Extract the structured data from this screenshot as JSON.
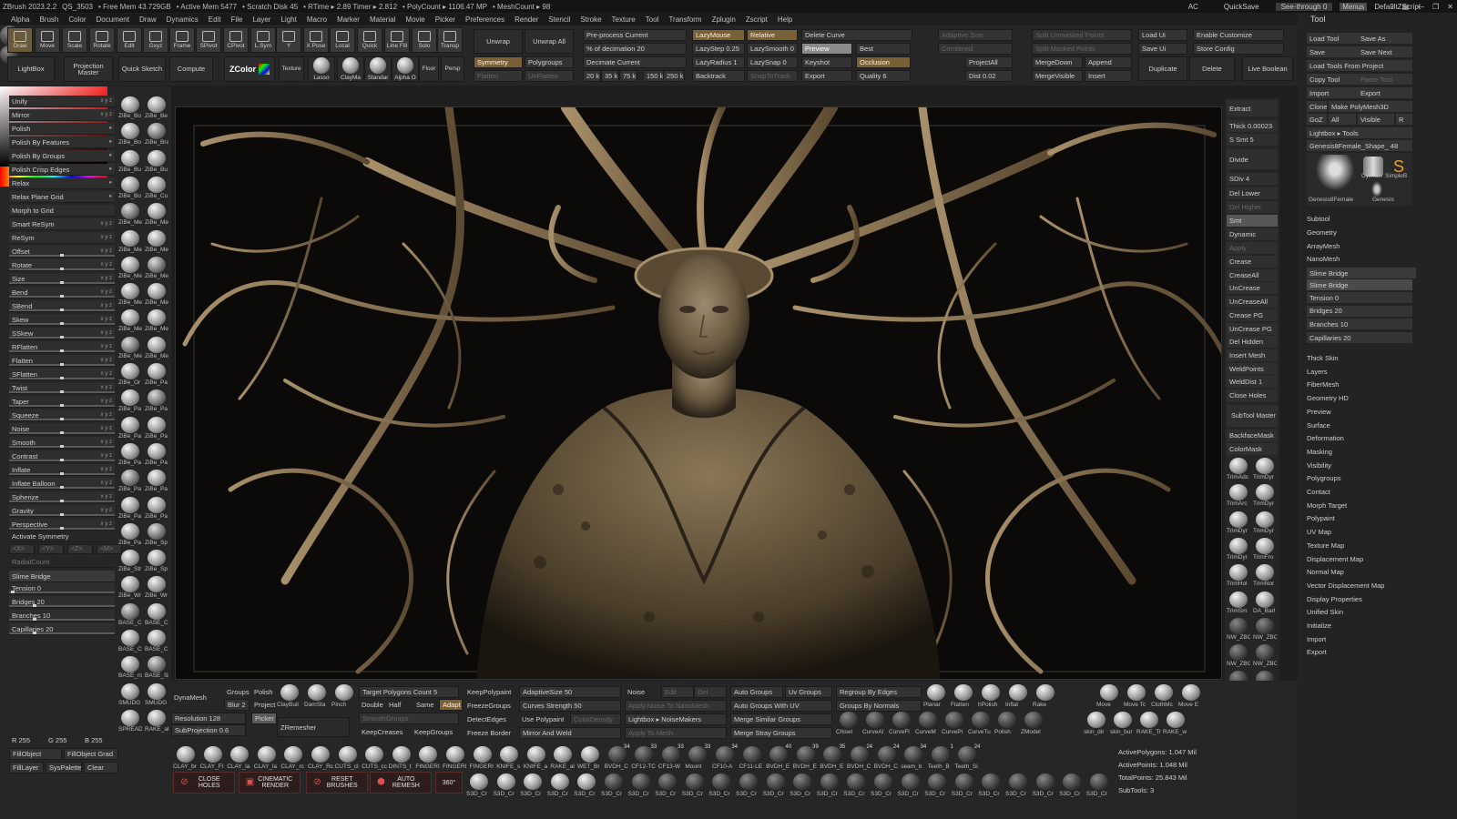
{
  "titlebar": {
    "items": [
      "ZBrush 2023.2.2",
      "QS_3503",
      "• Free Mem 43.729GB",
      "• Active Mem 5477",
      "• Scratch Disk 45",
      "• RTime ▸ 2.89 Timer ▸ 2.812",
      "• PolyCount ▸ 1106.47 MP",
      "• MeshCount ▸ 98"
    ],
    "right": {
      "ac": "AC",
      "quicksave": "QuickSave",
      "seethrough": "See-through  0",
      "menus": "Menus",
      "script": "DefaultZScript"
    }
  },
  "menubar": [
    "Alpha",
    "Brush",
    "Color",
    "Document",
    "Draw",
    "Dynamics",
    "Edit",
    "File",
    "Layer",
    "Light",
    "Macro",
    "Marker",
    "Material",
    "Movie",
    "Picker",
    "Preferences",
    "Render",
    "Stencil",
    "Stroke",
    "Texture",
    "Tool",
    "Transform",
    "Zplugin",
    "Zscript",
    "Help"
  ],
  "shelf": {
    "tools": [
      "Draw",
      "Move",
      "Scale",
      "Rotate",
      "Edit",
      "Gxyz",
      "Frame",
      "SPivot",
      "CPivot",
      "L.Sym",
      "Y",
      "X Pose",
      "Local",
      "Quick",
      "Line Fill",
      "Solo",
      "Transp"
    ],
    "row2": [
      "LightBox",
      "Projection Master",
      "Quick Sketch",
      "Compute",
      "ZColor",
      "Texture",
      "Lasso",
      "ClayMa",
      "Standar",
      "Alpha O",
      "Floor",
      "Persp"
    ],
    "unwrap": "Unwrap",
    "unwrap_all": "Unwrap All",
    "symmetry": "Symmetry",
    "flatten": "Flatten",
    "polygroups": "Polygroups",
    "unflatten": "UnFlatten",
    "preprocess": "Pre-process Current",
    "decimation": "% of decimation 20",
    "decimate": "Decimate Current",
    "dec_sizes": [
      "20 k",
      "35 k",
      "75 k",
      "150 k",
      "250 k"
    ],
    "lazymouse": "LazyMouse",
    "lazystep": "LazyStep 0.25",
    "lazyradius": "LazyRadius 1",
    "backtrack": "Backtrack",
    "relative": "Relative",
    "lazysmooth": "LazySmooth 0",
    "lazysnap": "LazySnap 0",
    "snaptotrack": "SnapToTrack",
    "deletecurve": "Delete Curve",
    "preview": "Preview",
    "best": "Best",
    "keyshot": "Keyshot",
    "occlusion": "Occlusion",
    "export": "Export",
    "quality": "Quality 6",
    "bpr": "BPR",
    "adaptive": "Adaptive Size",
    "combined": "Combined",
    "projectall": "ProjectAll",
    "dist": "Dist 0.02",
    "split_unmasked": "Split Unmasked Points",
    "split_masked": "Split Masked Points",
    "mergedown": "MergeDown",
    "mergevisible": "MergeVisible",
    "append": "Append",
    "insert": "Insert",
    "loadui": "Load Ui",
    "saveui": "Save Ui",
    "duplicate": "Duplicate",
    "delete": "Delete",
    "enable_customize": "Enable Customize",
    "store_config": "Store Config",
    "live_boolean": "Live Boolean"
  },
  "left": {
    "deformations": [
      {
        "label": "Unify",
        "k": "x y z"
      },
      {
        "label": "Mirror",
        "k": "x y z"
      },
      {
        "label": "Polish",
        "k": "●"
      },
      {
        "label": "Polish By Features",
        "k": "●"
      },
      {
        "label": "Polish By Groups",
        "k": "●"
      },
      {
        "label": "Polish Crisp Edges",
        "k": "●"
      },
      {
        "label": "Relax",
        "k": "●"
      },
      {
        "label": "Relax Plane Grid",
        "k": "●"
      },
      {
        "label": "Morph to Grid",
        "k": ""
      },
      {
        "label": "Smart ReSym",
        "k": "x y z"
      },
      {
        "label": "ReSym",
        "k": "x y z"
      },
      {
        "label": "Offset",
        "k": "x y z"
      },
      {
        "label": "Rotate",
        "k": "x y z"
      },
      {
        "label": "Size",
        "k": "x y z"
      },
      {
        "label": "Bend",
        "k": "x y z"
      },
      {
        "label": "SBend",
        "k": "x y z"
      },
      {
        "label": "Skew",
        "k": "x y z"
      },
      {
        "label": "SSkew",
        "k": "x y z"
      },
      {
        "label": "RFlatten",
        "k": "x y z"
      },
      {
        "label": "Flatten",
        "k": "x y z"
      },
      {
        "label": "SFlatten",
        "k": "x y z"
      },
      {
        "label": "Twist",
        "k": "x y z"
      },
      {
        "label": "Taper",
        "k": "x y z"
      },
      {
        "label": "Squeeze",
        "k": "x y z"
      },
      {
        "label": "Noise",
        "k": "x y z"
      },
      {
        "label": "Smooth",
        "k": "x y z"
      },
      {
        "label": "Contrast",
        "k": "x y z"
      },
      {
        "label": "Inflate",
        "k": "x y z"
      },
      {
        "label": "Inflate Balloon",
        "k": "x y z"
      },
      {
        "label": "Spherize",
        "k": "x y z"
      },
      {
        "label": "Gravity",
        "k": "x y z"
      },
      {
        "label": "Perspective",
        "k": "x y z"
      }
    ],
    "activate_symmetry": "Activate Symmetry",
    "axes": [
      "<X>",
      "<Y>",
      "<Z>",
      "<M>"
    ],
    "radial": "(R)",
    "radialcount": "RadialCount",
    "slime": {
      "title": "Slime Bridge",
      "tension": "Tension 0",
      "bridges": "Bridges 20",
      "branches": "Branches 10",
      "capillaries": "Capillaries 20"
    },
    "thumbs": [
      "ZiBe_Bo",
      "ZiBe_Be",
      "ZiBe_Bo",
      "ZiBe_Bra",
      "ZiBe_Bu",
      "ZiBe_Bu",
      "ZiBe_Bo",
      "ZiBe_Cu",
      "ZiBe_Me",
      "ZiBe_Me",
      "ZiBe_Me",
      "ZiBe_Me",
      "ZiBe_Me",
      "ZiBe_Me",
      "ZiBe_Me",
      "ZiBe_Me",
      "ZiBe_Me",
      "ZiBe_Me",
      "ZiBe_Me",
      "ZiBe_Me",
      "ZiBe_Or",
      "ZiBe_Pa",
      "ZiBe_Pa",
      "ZiBe_Pa",
      "ZiBe_Pa",
      "ZiBe_Pa",
      "ZiBe_Pa",
      "ZiBe_Pa",
      "ZiBe_Pa",
      "ZiBe_Pa",
      "ZiBe_Pa",
      "ZiBe_Pa",
      "ZiBe_Pa",
      "ZiBe_Sp",
      "ZiBe_Str",
      "ZiBe_Sp",
      "ZiBe_Wr",
      "ZiBe_Wr",
      "BASE_C",
      "BASE_Cl",
      "BASE_Cl",
      "BASE_Cl",
      "BASE_rc",
      "BASE_Sr",
      "SMUDG",
      "SMUDG",
      "SPREAD",
      "RAKE_al"
    ],
    "rgb": {
      "r": "R 255",
      "g": "G 255",
      "b": "B 255"
    },
    "fillobject": "FillObject",
    "fillobject_grad": "FillObject Grad",
    "filllayer": "FillLayer",
    "syspalette": "SysPalette",
    "clear": "Clear"
  },
  "midright": {
    "extract": "Extract",
    "thick": "Thick 0.00023",
    "smt": "S Smt 5",
    "divide": "Divide",
    "sdiv": "SDiv 4",
    "dellower": "Del Lower",
    "delhigher": "Del Higher",
    "smt2": "Smt",
    "dynamic": "Dynamic",
    "apply": "Apply",
    "items": [
      "Crease",
      "CreaseAll",
      "UnCrease",
      "UnCreaseAll",
      "Crease PG",
      "UnCrease PG",
      "Del Hidden",
      "Insert Mesh",
      "WeldPoints",
      "WeldDist 1",
      "Close Holes"
    ],
    "subtool_master": "SubTool Master",
    "backface": "BackfaceMask",
    "colormask": "ColorMask",
    "brushes": [
      "TrimAdc",
      "TrimDyr",
      "TrimArc",
      "TrimDyr",
      "TrimDyr",
      "TrimDyr",
      "TrimDyr",
      "TrimFro",
      "TrimHol",
      "TrimNor",
      "TrimSm",
      "DA_Barl",
      "NW_ZBC",
      "NW_ZBC",
      "NW_ZBC",
      "NW_ZBC",
      "NW_ZBC",
      "NW_ZBC",
      "NW_ZBC",
      "NW_ZBC",
      "NW_ZBC",
      "NW_ZBC"
    ]
  },
  "toolpal": {
    "title": "Tool",
    "buttons": [
      "Load Tool",
      "Save As",
      "Save",
      "Save Next",
      "Load Tools From Project",
      "Copy Tool",
      "Paste Tool",
      "Import",
      "Export",
      "Clone",
      "Make PolyMesh3D",
      "GoZ",
      "All",
      "Visible",
      "R"
    ],
    "lightbox_tools": "Lightbox ▸ Tools",
    "current_tool": "Genesis8Female_Shape_ 48",
    "tool_names": [
      "Genesis8Female",
      "Cylinder",
      "SimpleB",
      "Genesis"
    ],
    "subtool": "Subtool",
    "geometry": "Geometry",
    "arraymesh": "ArrayMesh",
    "nanomesh": "NanoMesh",
    "slime": {
      "title": "Slime Bridge",
      "button": "Slime Bridge",
      "tension": "Tension 0",
      "bridges": "Bridges 20",
      "branches": "Branches 10",
      "capillaries": "Capillaries 20"
    },
    "menu": [
      "Thick Skin",
      "Layers",
      "FiberMesh",
      "Geometry HD",
      "Preview",
      "Surface",
      "Deformation",
      "Masking",
      "Visibility",
      "Polygroups",
      "Contact",
      "Morph Target",
      "Polypaint",
      "UV Map",
      "Texture Map",
      "Displacement Map",
      "Normal Map",
      "Vector Displacement Map",
      "Display Properties",
      "Unified Skin",
      "Initialize",
      "Import",
      "Export"
    ]
  },
  "bottom": {
    "dynamesh": "DynaMesh",
    "groups": "Groups",
    "polish": "Polish",
    "blur": "Blur 2",
    "project": "Project",
    "resolution": "Resolution 128",
    "subprojection": "SubProjection 0.6",
    "zremesher": "ZRemesher",
    "picker": "Picker",
    "claybrushes": [
      "ClayBuil",
      "DamSta",
      "Pinch"
    ],
    "target_poly": "Target Polygons Count 5",
    "double": "Double",
    "half": "Half",
    "same": "Same",
    "adapt": "Adapt",
    "smoothgroups": "SmoothGroups",
    "keepcreases": "KeepCreases",
    "keepgroups": "KeepGroups",
    "keeppolypaint": "KeepPolypaint",
    "freezegroups": "FreezeGroups",
    "detectedges": "DetectEdges",
    "freezeborder": "Freeze Border",
    "adaptivesize": "AdaptiveSize 50",
    "curvesstrength": "Curves Strength 50",
    "usepolypaint": "Use Polypaint",
    "colordensity": "ColorDensity",
    "mirrorweld": "Mirror And Weld",
    "noise": "Noise",
    "edit": "Edit",
    "del": "Del",
    "apply_noise": "Apply Noise To NanoMesh",
    "lightbox_noise": "Lightbox ▸ NoiseMakers",
    "apply_mesh": "Apply To Mesh",
    "autogroups": "Auto Groups",
    "autogroups_uv": "Auto Groups With UV",
    "merge_similar": "Merge Similar Groups",
    "merge_stray": "Merge Stray Groups",
    "uvgroups": "Uv Groups",
    "regroup_edges": "Regroup By Edges",
    "groups_normals": "Groups By Normals",
    "rightbrushes": [
      "Planar",
      "Flatten",
      "hPolish",
      "Inflat",
      "Rake",
      "Move",
      "Move Tc",
      "ClothMc",
      "Move E"
    ],
    "rightbrushes2": [
      "Chisel",
      "CurveAl",
      "CurveFl",
      "CurveM",
      "CurvePi",
      "CurveTu",
      "Polish",
      "ZModel",
      "skin_dir",
      "skin_bur",
      "RAKE_Tr",
      "RAKE_w"
    ],
    "brushrow1": [
      "CLAY_br",
      "CLAY_Fl",
      "CLAY_la",
      "CLAY_la",
      "CLAY_rc",
      "CLAY_Rc",
      "CUTS_cl",
      "CUTS_cc",
      "DINTS_t",
      "FINGERI",
      "FINGERI",
      "FINGERI",
      "KNIFE_s",
      "KNIFE_a",
      "RAKE_al",
      "WET_Br",
      "BVDH_C",
      "CF12-TC",
      "CF13-W",
      "Mount",
      "CF10-A",
      "CF11-LE",
      "BVDH_E",
      "BVDH_E",
      "BVDH_E",
      "BVDH_C",
      "BVDH_C",
      "seam_b",
      "Teeth_B",
      "Teeth_Si"
    ],
    "brushrow1_nums": [
      "",
      "",
      "",
      "",
      "",
      "",
      "",
      "",
      "",
      "",
      "",
      "",
      "",
      "",
      "",
      "",
      "34",
      "33",
      "33",
      "33",
      "34",
      "",
      "40",
      "39",
      "35",
      "24",
      "24",
      "34",
      "1",
      "24"
    ],
    "buttons": [
      {
        "icon": "⊘",
        "label": "CLOSE HOLES"
      },
      {
        "icon": "▣",
        "label": "CINEMATIC RENDER"
      },
      {
        "icon": "⊘",
        "label": "RESET BRUSHES"
      },
      {
        "icon": "⬢",
        "label": "AUTO REMESH"
      }
    ],
    "brushrow2_prefix": "S3D_Cr",
    "stats": [
      "ActivePolygons: 1.047 Mil",
      "ActivePoints: 1.048 Mil",
      "TotalPoints: 25.843 Mil",
      "SubTools: 3"
    ]
  },
  "colors": {
    "accent": "#7a6036",
    "bg": "#262626",
    "highlight": "#8a6a3a"
  }
}
